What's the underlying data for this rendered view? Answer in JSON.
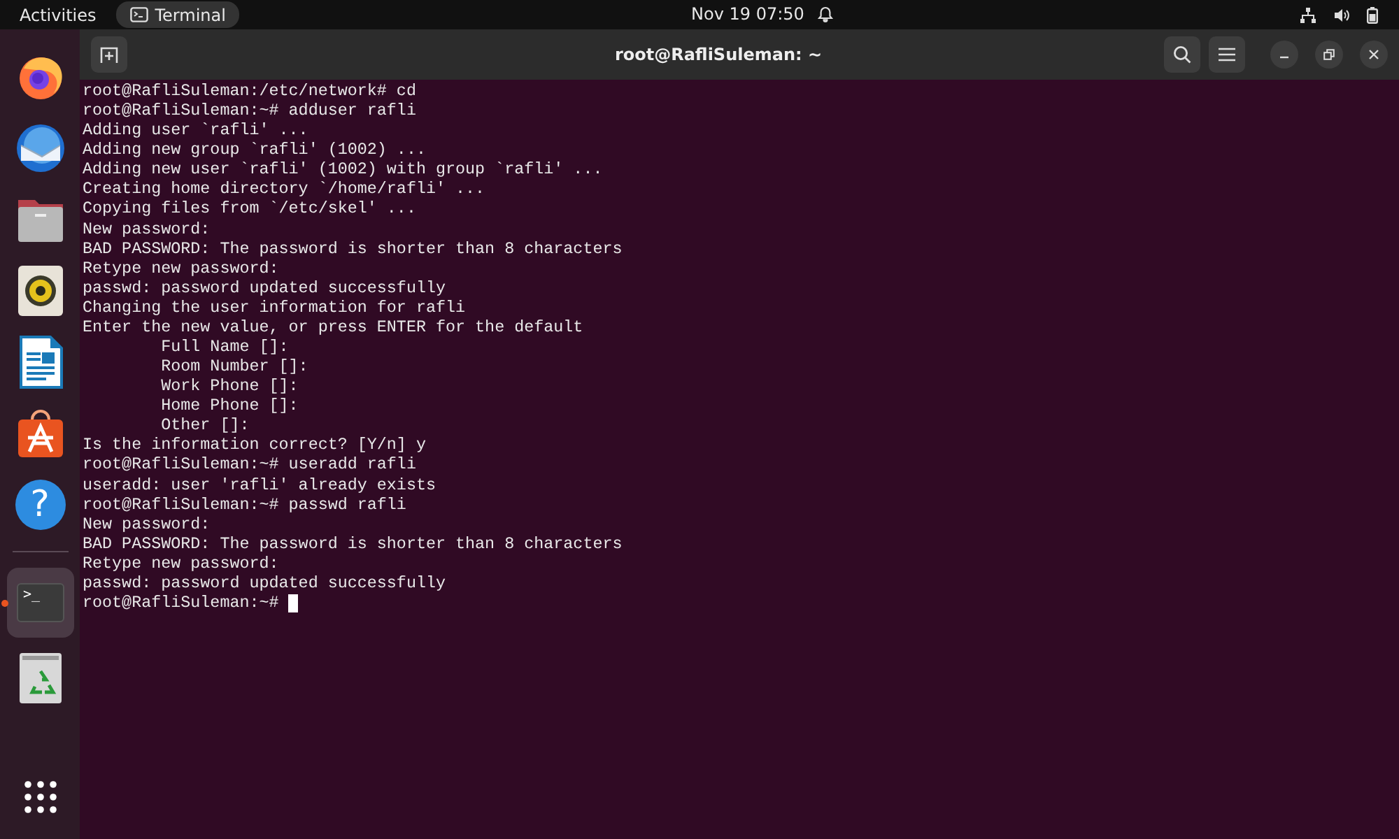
{
  "top_bar": {
    "activities": "Activities",
    "app": {
      "label": "Terminal"
    },
    "clock": "Nov 19  07:50"
  },
  "dock": {
    "items": [
      {
        "kind": "firefox",
        "running": false,
        "selected": false
      },
      {
        "kind": "thunderbird",
        "running": false,
        "selected": false
      },
      {
        "kind": "files",
        "running": false,
        "selected": false
      },
      {
        "kind": "rhythmbox",
        "running": false,
        "selected": false
      },
      {
        "kind": "writer",
        "running": false,
        "selected": false
      },
      {
        "kind": "appcenter",
        "running": false,
        "selected": false
      },
      {
        "kind": "help",
        "glyph": "?",
        "running": false,
        "selected": false
      },
      {
        "kind": "terminal",
        "glyph": ">_",
        "running": true,
        "selected": true
      },
      {
        "kind": "trash",
        "running": false,
        "selected": false
      }
    ]
  },
  "window": {
    "title": "root@RafliSuleman: ~"
  },
  "terminal": {
    "lines": [
      "root@RafliSuleman:/etc/network# cd",
      "root@RafliSuleman:~# adduser rafli",
      "Adding user `rafli' ...",
      "Adding new group `rafli' (1002) ...",
      "Adding new user `rafli' (1002) with group `rafli' ...",
      "Creating home directory `/home/rafli' ...",
      "Copying files from `/etc/skel' ...",
      "New password:",
      "BAD PASSWORD: The password is shorter than 8 characters",
      "Retype new password:",
      "passwd: password updated successfully",
      "Changing the user information for rafli",
      "Enter the new value, or press ENTER for the default",
      "        Full Name []:",
      "        Room Number []:",
      "        Work Phone []:",
      "        Home Phone []:",
      "        Other []:",
      "Is the information correct? [Y/n] y",
      "root@RafliSuleman:~# useradd rafli",
      "useradd: user 'rafli' already exists",
      "root@RafliSuleman:~# passwd rafli",
      "New password:",
      "BAD PASSWORD: The password is shorter than 8 characters",
      "Retype new password:",
      "passwd: password updated successfully"
    ],
    "prompt": "root@RafliSuleman:~#"
  }
}
